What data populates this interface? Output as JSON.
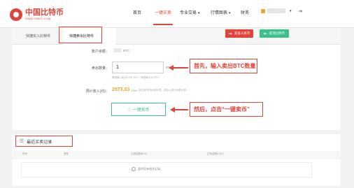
{
  "brand": {
    "name_cn": "中国比特币",
    "name_en": "WWW.CHBTC.COM"
  },
  "nav": {
    "home": "首页",
    "quick_trade": "一键买卖",
    "pro_trade": "专业交易",
    "charts": "行情图表",
    "finance": "财务"
  },
  "tabs": {
    "buy": "快捷买入比特币",
    "sell": "快捷卖出比特币"
  },
  "actions": {
    "recharge": "充值人民币",
    "withdraw": "提现比特币"
  },
  "form": {
    "balance_label": "账户余额：",
    "balance_unit": "BTC",
    "qty_label": "卖出数量：",
    "qty_value": "1",
    "qty_unit": "BTC",
    "qty_hint": "单笔最小卖出0.001 BTC，单笔最大10 BTC",
    "price_label": "预计收入(约)：",
    "price_value": "2973.03",
    "price_unit": "CNY",
    "price_note": "(按当前市场价格计算，实际以成交价格为准)",
    "submit": "一键卖币"
  },
  "callouts": {
    "step1": "首先，输入卖出BTC数量",
    "step2": "然后，点击“一键卖币”"
  },
  "records": {
    "title": "最近买卖记录",
    "columns": [
      "时间",
      "类型",
      "交易金额(BTC)",
      "交易金额(CNY)"
    ],
    "empty_message": "暂时没有相关记录。"
  },
  "colors": {
    "accent": "#e0443a",
    "green": "#3ec08c",
    "price": "#e0a82c"
  }
}
